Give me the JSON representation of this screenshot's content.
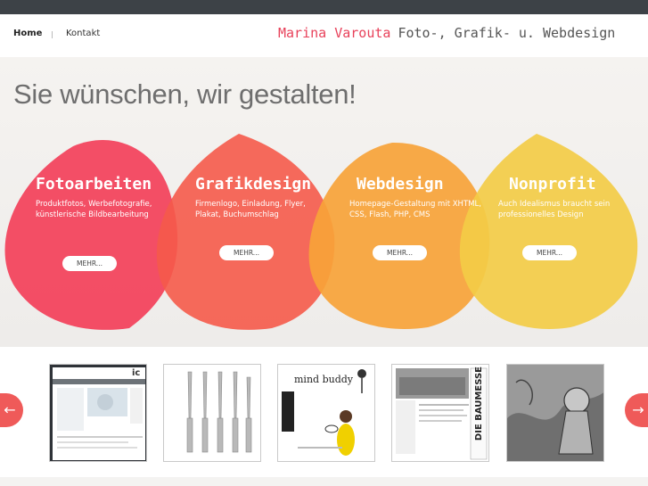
{
  "nav": {
    "home": "Home",
    "kontakt": "Kontakt"
  },
  "brand": {
    "name": "Marina Varouta",
    "tagline": "Foto-, Grafik- u. Webdesign"
  },
  "hero": {
    "title": "Sie wünschen, wir gestalten!"
  },
  "cards": [
    {
      "title": "Fotoarbeiten",
      "desc": "Produktfotos, Werbefotografie, künstlerische Bildbearbeitung",
      "button": "MEHR...",
      "color": "#f2455e"
    },
    {
      "title": "Grafikdesign",
      "desc": "Firmenlogo, Einladung, Flyer, Plakat, Buchumschlag",
      "button": "MEHR...",
      "color": "#f55a4a"
    },
    {
      "title": "Webdesign",
      "desc": "Homepage-Gestaltung mit XHTML, CSS, Flash, PHP, CMS",
      "button": "MEHR...",
      "color": "#f7a338"
    },
    {
      "title": "Nonprofit",
      "desc": "Auch Idealismus braucht sein professionelles Design",
      "button": "MEHR...",
      "color": "#f3cc46"
    }
  ],
  "carousel": {
    "prev_icon": "arrow-left-icon",
    "next_icon": "arrow-right-icon",
    "thumbs": [
      {
        "name": "website-screenshot",
        "label": "ic"
      },
      {
        "name": "dental-drills",
        "label": ""
      },
      {
        "name": "mind-buddy",
        "label": "mind buddy"
      },
      {
        "name": "baumesse",
        "label": "DIE BAUMESSE"
      },
      {
        "name": "artwork-figure",
        "label": ""
      }
    ]
  }
}
